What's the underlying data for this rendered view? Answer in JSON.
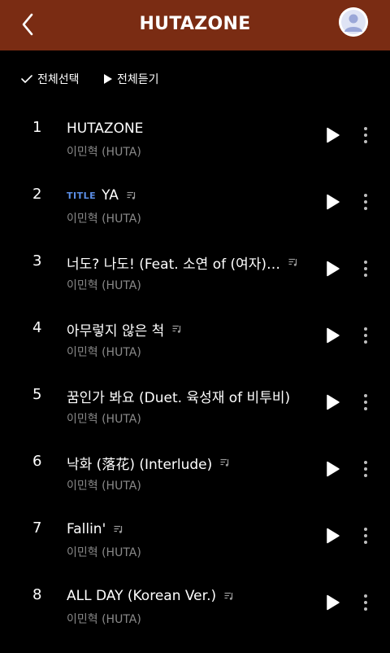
{
  "header": {
    "title": "HUTAZONE",
    "background_color": "#7a2c13",
    "back_icon": "chevron-left-icon",
    "avatar_icon": "user-avatar-icon"
  },
  "toolbar": {
    "select_all_label": "전체선택",
    "select_all_icon": "check-icon",
    "play_all_label": "전체듣기",
    "play_all_icon": "play-icon"
  },
  "colors": {
    "title_badge": "#5b8ee6",
    "artist_text": "#8a8a8a",
    "background": "#000000"
  },
  "tracks": [
    {
      "number": "1",
      "badge": "",
      "title": "HUTAZONE",
      "artist": "이민혁 (HUTA)",
      "has_lyrics": false
    },
    {
      "number": "2",
      "badge": "TITLE",
      "title": "YA",
      "artist": "이민혁 (HUTA)",
      "has_lyrics": true
    },
    {
      "number": "3",
      "badge": "",
      "title": "너도? 나도! (Feat. 소연 of (여자)…",
      "artist": "이민혁 (HUTA)",
      "has_lyrics": true
    },
    {
      "number": "4",
      "badge": "",
      "title": "아무렇지 않은 척",
      "artist": "이민혁 (HUTA)",
      "has_lyrics": true
    },
    {
      "number": "5",
      "badge": "",
      "title": "꿈인가 봐요 (Duet. 육성재 of 비투비)",
      "artist": "이민혁 (HUTA)",
      "has_lyrics": false
    },
    {
      "number": "6",
      "badge": "",
      "title": "낙화 (落花) (Interlude)",
      "artist": "이민혁 (HUTA)",
      "has_lyrics": true
    },
    {
      "number": "7",
      "badge": "",
      "title": "Fallin'",
      "artist": "이민혁 (HUTA)",
      "has_lyrics": true
    },
    {
      "number": "8",
      "badge": "",
      "title": "ALL DAY (Korean Ver.)",
      "artist": "이민혁 (HUTA)",
      "has_lyrics": true
    }
  ]
}
